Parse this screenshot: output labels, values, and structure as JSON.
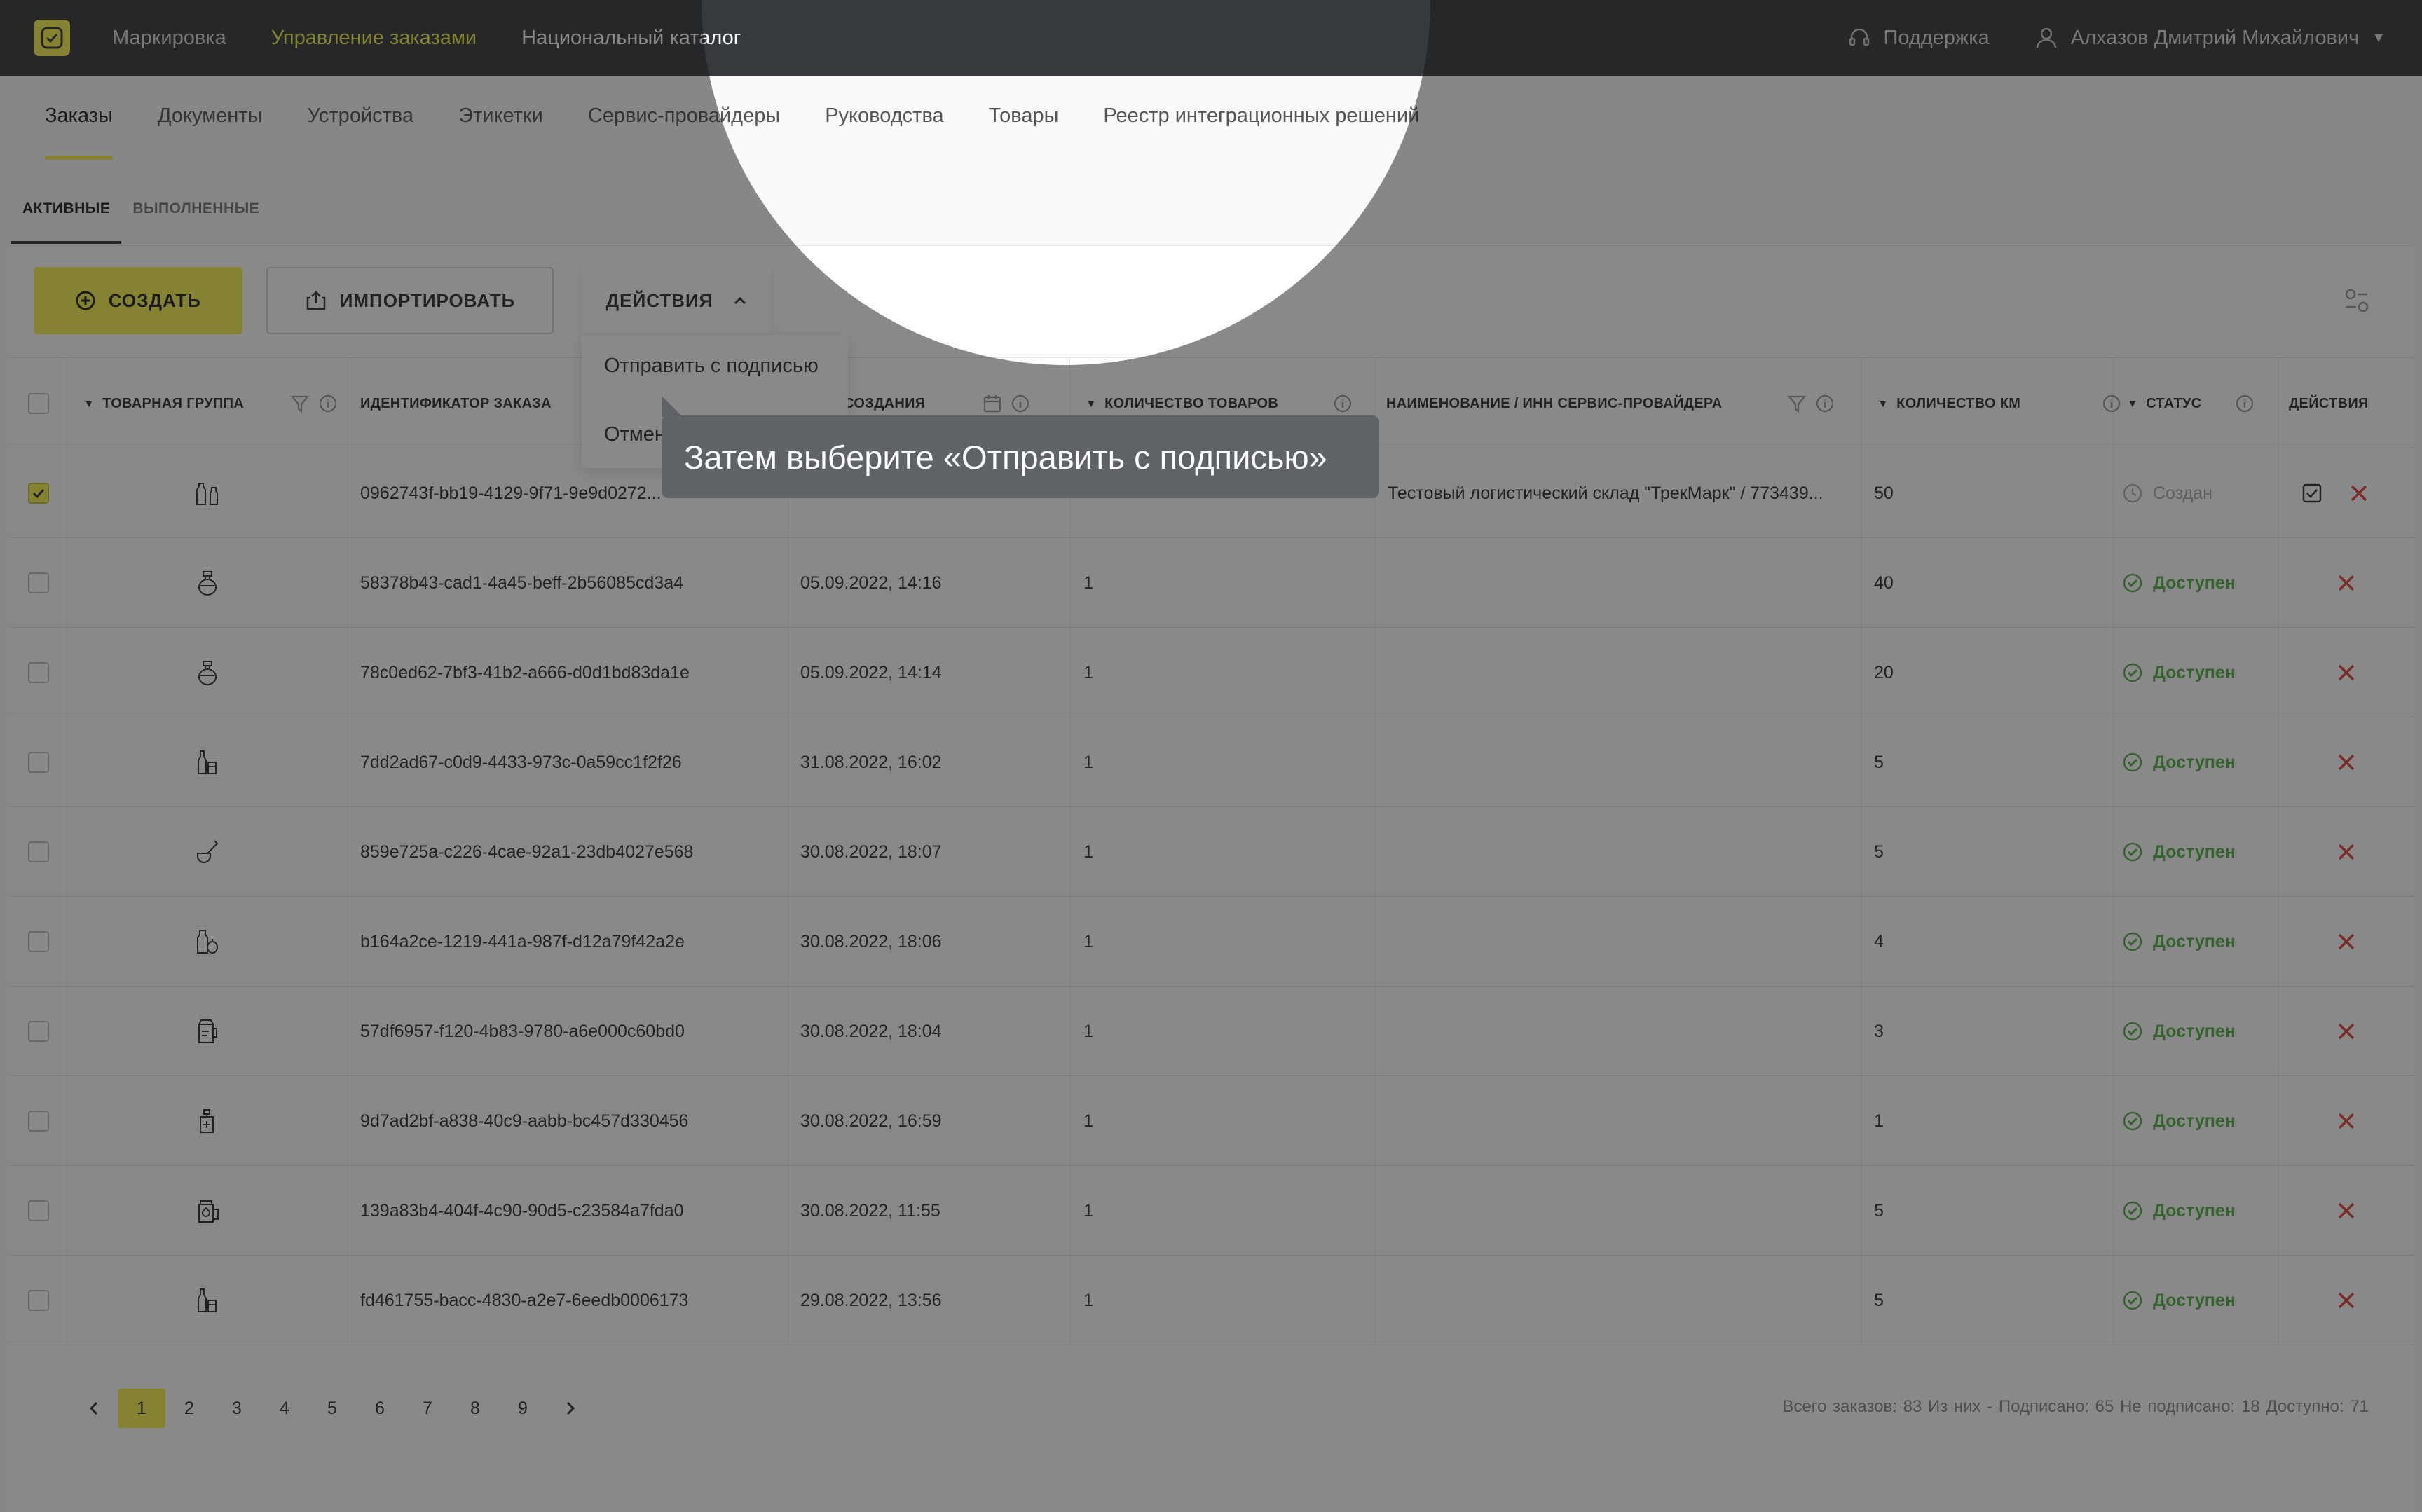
{
  "header": {
    "nav": [
      "Маркировка",
      "Управление заказами",
      "Национальный каталог"
    ],
    "active_nav": "Управление заказами",
    "support": "Поддержка",
    "user": "Алхазов Дмитрий Михайлович"
  },
  "section_tabs": [
    "Заказы",
    "Документы",
    "Устройства",
    "Этикетки",
    "Сервис-провайдеры",
    "Руководства",
    "Товары",
    "Реестр интеграционных решений"
  ],
  "sub_tabs": [
    "АКТИВНЫЕ",
    "ВЫПОЛНЕННЫЕ"
  ],
  "toolbar": {
    "create": "СОЗДАТЬ",
    "import": "ИМПОРТИРОВАТЬ",
    "actions": "ДЕЙСТВИЯ"
  },
  "dropdown": {
    "items": [
      "Отправить с подписью",
      "Отменить"
    ]
  },
  "table": {
    "columns": [
      "ТОВАРНАЯ ГРУППА",
      "ИДЕНТИФИКАТОР ЗАКАЗА",
      "ДАТА СОЗДАНИЯ",
      "КОЛИЧЕСТВО ТОВАРОВ",
      "НАИМЕНОВАНИЕ / ИНН СЕРВИС-ПРОВАЙДЕРА",
      "КОЛИЧЕСТВО КМ",
      "СТАТУС",
      "ДЕЙСТВИЯ"
    ],
    "rows": [
      {
        "checked": true,
        "group_icon": "bottles-icon",
        "id": "0962743f-bb19-4129-9f71-9e9d0272...",
        "date": "",
        "qty": "",
        "provider": "Тестовый логистический склад \"ТрекМарк\" / 773439...",
        "km": "50",
        "status": "Создан",
        "created": true
      },
      {
        "checked": false,
        "group_icon": "perfume-icon",
        "id": "58378b43-cad1-4a45-beff-2b56085cd3a4",
        "date": "05.09.2022, 14:16",
        "qty": "1",
        "provider": "",
        "km": "40",
        "status": "Доступен",
        "created": false
      },
      {
        "checked": false,
        "group_icon": "perfume-icon",
        "id": "78c0ed62-7bf3-41b2-a666-d0d1bd83da1e",
        "date": "05.09.2022, 14:14",
        "qty": "1",
        "provider": "",
        "km": "20",
        "status": "Доступен",
        "created": false
      },
      {
        "checked": false,
        "group_icon": "beer-bottles-icon",
        "id": "7dd2ad67-c0d9-4433-973c-0a59cc1f2f26",
        "date": "31.08.2022, 16:02",
        "qty": "1",
        "provider": "",
        "km": "5",
        "status": "Доступен",
        "created": false
      },
      {
        "checked": false,
        "group_icon": "pipe-icon",
        "id": "859e725a-c226-4cae-92a1-23db4027e568",
        "date": "30.08.2022, 18:07",
        "qty": "1",
        "provider": "",
        "km": "5",
        "status": "Доступен",
        "created": false
      },
      {
        "checked": false,
        "group_icon": "juice-icon",
        "id": "b164a2ce-1219-441a-987f-d12a79f42a2e",
        "date": "30.08.2022, 18:06",
        "qty": "1",
        "provider": "",
        "km": "4",
        "status": "Доступен",
        "created": false
      },
      {
        "checked": false,
        "group_icon": "non-alcohol-beer-icon",
        "id": "57df6957-f120-4b83-9780-a6e000c60bd0",
        "date": "30.08.2022, 18:04",
        "qty": "1",
        "provider": "",
        "km": "3",
        "status": "Доступен",
        "created": false
      },
      {
        "checked": false,
        "group_icon": "antiseptic-icon",
        "id": "9d7ad2bf-a838-40c9-aabb-bc457d330456",
        "date": "30.08.2022, 16:59",
        "qty": "1",
        "provider": "",
        "km": "1",
        "status": "Доступен",
        "created": false
      },
      {
        "checked": false,
        "group_icon": "supplements-icon",
        "id": "139a83b4-404f-4c90-90d5-c23584a7fda0",
        "date": "30.08.2022, 11:55",
        "qty": "1",
        "provider": "",
        "km": "5",
        "status": "Доступен",
        "created": false
      },
      {
        "checked": false,
        "group_icon": "beer-bottles-icon",
        "id": "fd461755-bacc-4830-a2e7-6eedb0006173",
        "date": "29.08.2022, 13:56",
        "qty": "1",
        "provider": "",
        "km": "5",
        "status": "Доступен",
        "created": false
      }
    ]
  },
  "pagination": {
    "pages": [
      "1",
      "2",
      "3",
      "4",
      "5",
      "6",
      "7",
      "8",
      "9"
    ],
    "current": "1"
  },
  "totals": "Всего заказов: 83   Из них -   Подписано: 65   Не подписано: 18   Доступно: 71",
  "tooltip": "Затем выберите «Отправить с подписью»",
  "colors": {
    "accent": "#f6f14e",
    "header_bg": "#363a3f",
    "available": "#58b04a",
    "delete": "#e24141"
  }
}
